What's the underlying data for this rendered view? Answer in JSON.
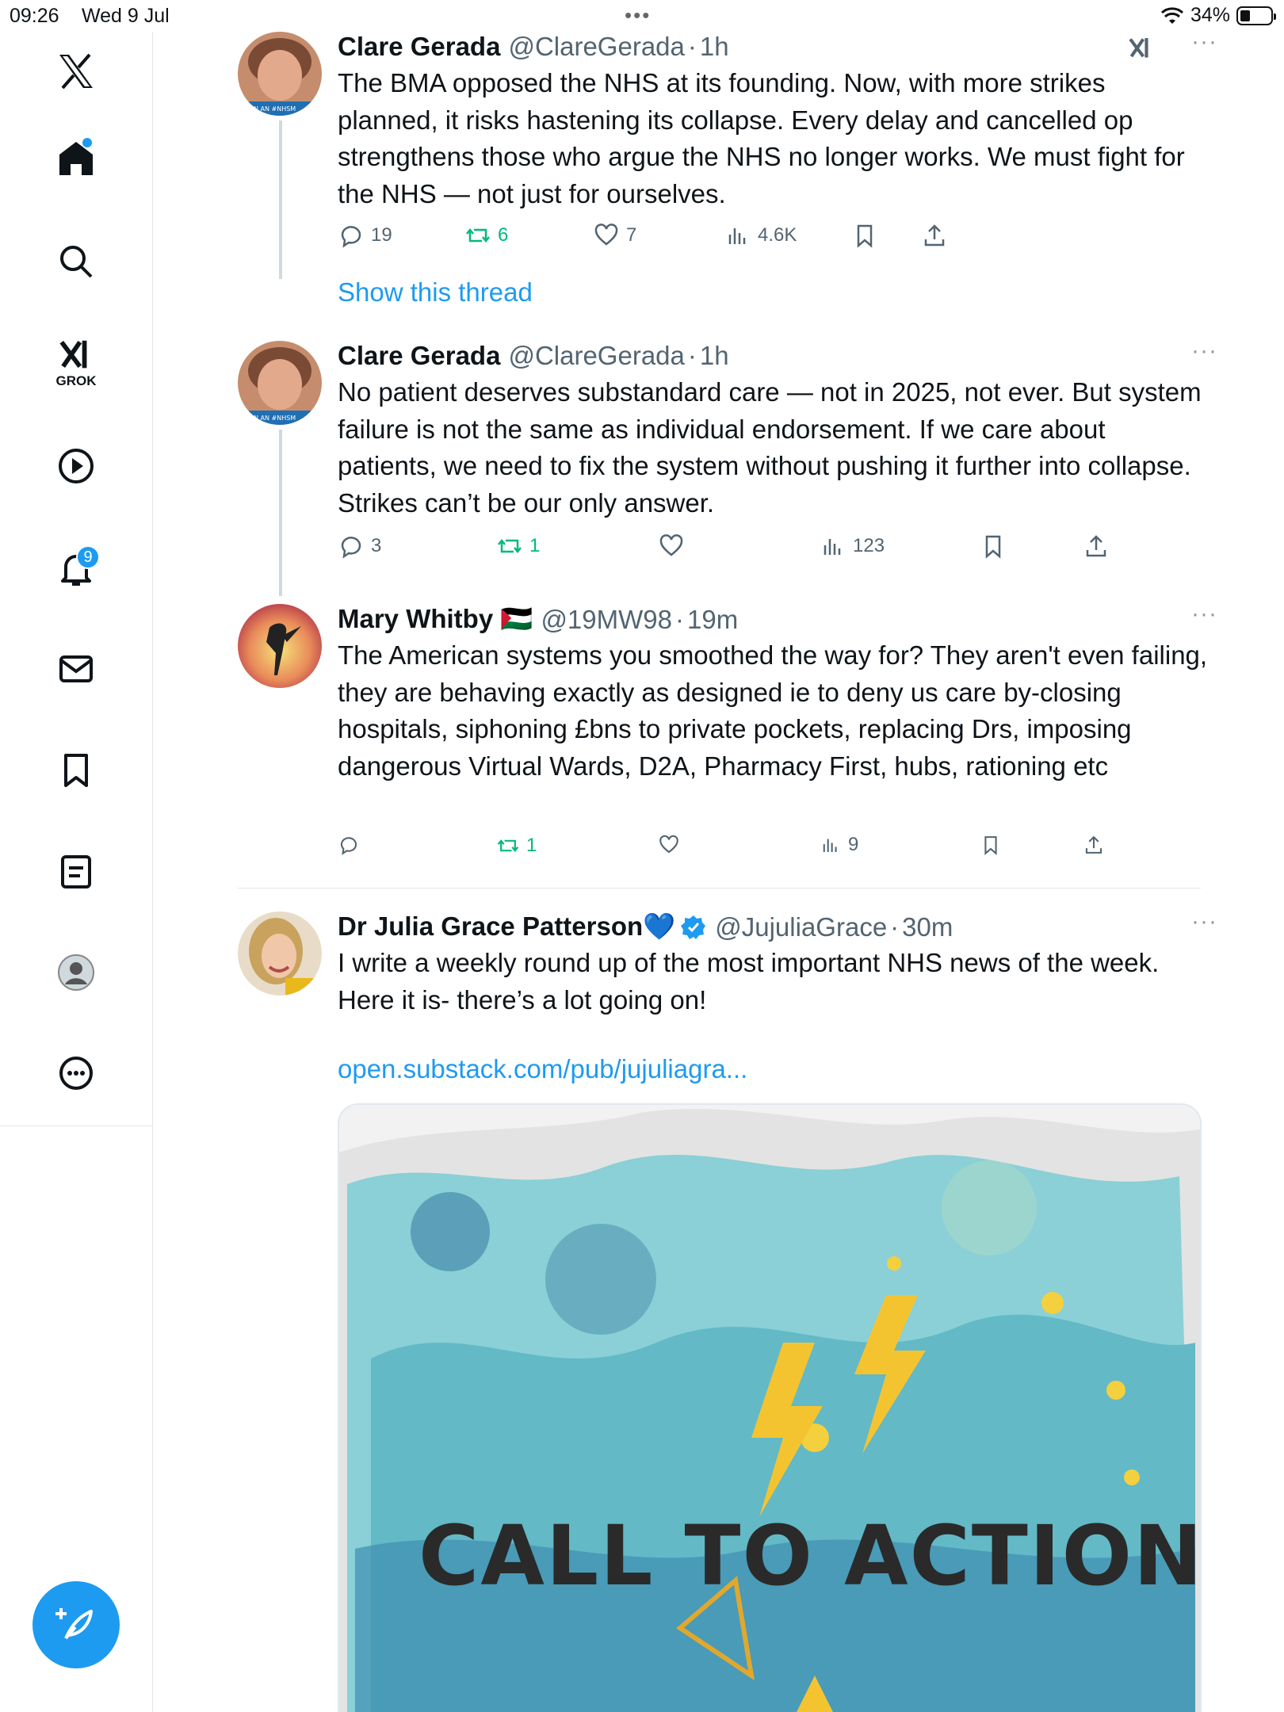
{
  "status_bar": {
    "time": "09:26",
    "date": "Wed 9 Jul",
    "battery": "34%",
    "battery_level": 0.34
  },
  "sidebar": {
    "items": [
      {
        "name": "x-logo"
      },
      {
        "name": "home",
        "has_dot": true
      },
      {
        "name": "search"
      },
      {
        "name": "grok",
        "label": "GROK"
      },
      {
        "name": "video"
      },
      {
        "name": "notifications",
        "badge": "9"
      },
      {
        "name": "messages"
      },
      {
        "name": "bookmarks"
      },
      {
        "name": "lists"
      },
      {
        "name": "profile"
      },
      {
        "name": "more"
      }
    ]
  },
  "tweets": [
    {
      "name": "Clare Gerada",
      "handle": "@ClareGerada",
      "time": "1h",
      "text": "The BMA opposed the NHS at its founding. Now, with more strikes planned, it risks hastening its collapse. Every delay and cancelled op strengthens those who argue the NHS no longer works. We must fight for the NHS — not just for ourselves.",
      "replies": "19",
      "retweets": "6",
      "likes": "7",
      "views": "4.6K",
      "show_thread": "Show this thread"
    },
    {
      "name": "Clare Gerada",
      "handle": "@ClareGerada",
      "time": "1h",
      "text": "No patient deserves substandard care — not in 2025, not ever. But system failure is not the same as individual endorsement. If we care about patients, we need to fix the system without pushing it further into collapse. Strikes can’t be our only answer.",
      "replies": "3",
      "retweets": "1",
      "views": "123"
    },
    {
      "name": "Mary Whitby 🇵🇸",
      "handle": "@19MW98",
      "time": "19m",
      "text": "The American systems you smoothed the way for? They aren't even failing, they are behaving exactly as designed ie to deny us care by-closing hospitals, siphoning £bns to private pockets, replacing Drs, imposing dangerous Virtual Wards, D2A, Pharmacy First, hubs, rationing etc",
      "retweets": "1",
      "views": "9"
    },
    {
      "name": "Dr Julia Grace Patterson💙",
      "handle": "@JujuliaGrace",
      "time": "30m",
      "text_line1": "I write a weekly round up of the most important NHS news of the week.",
      "text_line2": "Here it is- there’s a lot going on!",
      "link": "open.substack.com/pub/jujuliagra...",
      "card_text": "CALL TO ACTION."
    }
  ],
  "ui": {
    "separator": "·",
    "more": "···",
    "verified": true
  }
}
